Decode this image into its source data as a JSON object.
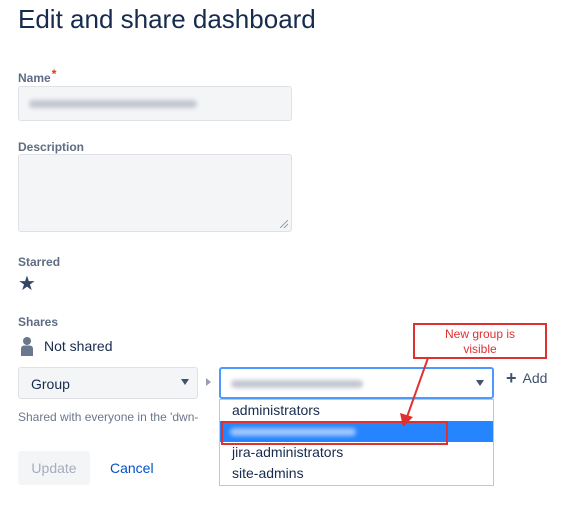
{
  "page": {
    "title": "Edit and share dashboard"
  },
  "form": {
    "name_label": "Name",
    "required_mark": "*",
    "description_label": "Description",
    "starred_label": "Starred",
    "shares_label": "Shares",
    "shares_status": "Not shared",
    "share_type_value": "Group",
    "add_label": "Add",
    "help_text": "Shared with everyone in the 'dwn-",
    "update_label": "Update",
    "cancel_label": "Cancel"
  },
  "dropdown": {
    "options": [
      "administrators",
      "",
      "jira-administrators",
      "site-admins"
    ],
    "selected_index": 1
  },
  "annotation": {
    "callout_line1": "New group is",
    "callout_line2": "visible",
    "color": "#e03131"
  },
  "icons": {
    "star": "star-icon",
    "person": "person-icon",
    "plus": "plus-icon",
    "caret": "chevron-down-icon"
  },
  "colors": {
    "accent": "#0052cc",
    "selection": "#2684ff",
    "focus_border": "#4c9aff",
    "required": "#de350b"
  }
}
